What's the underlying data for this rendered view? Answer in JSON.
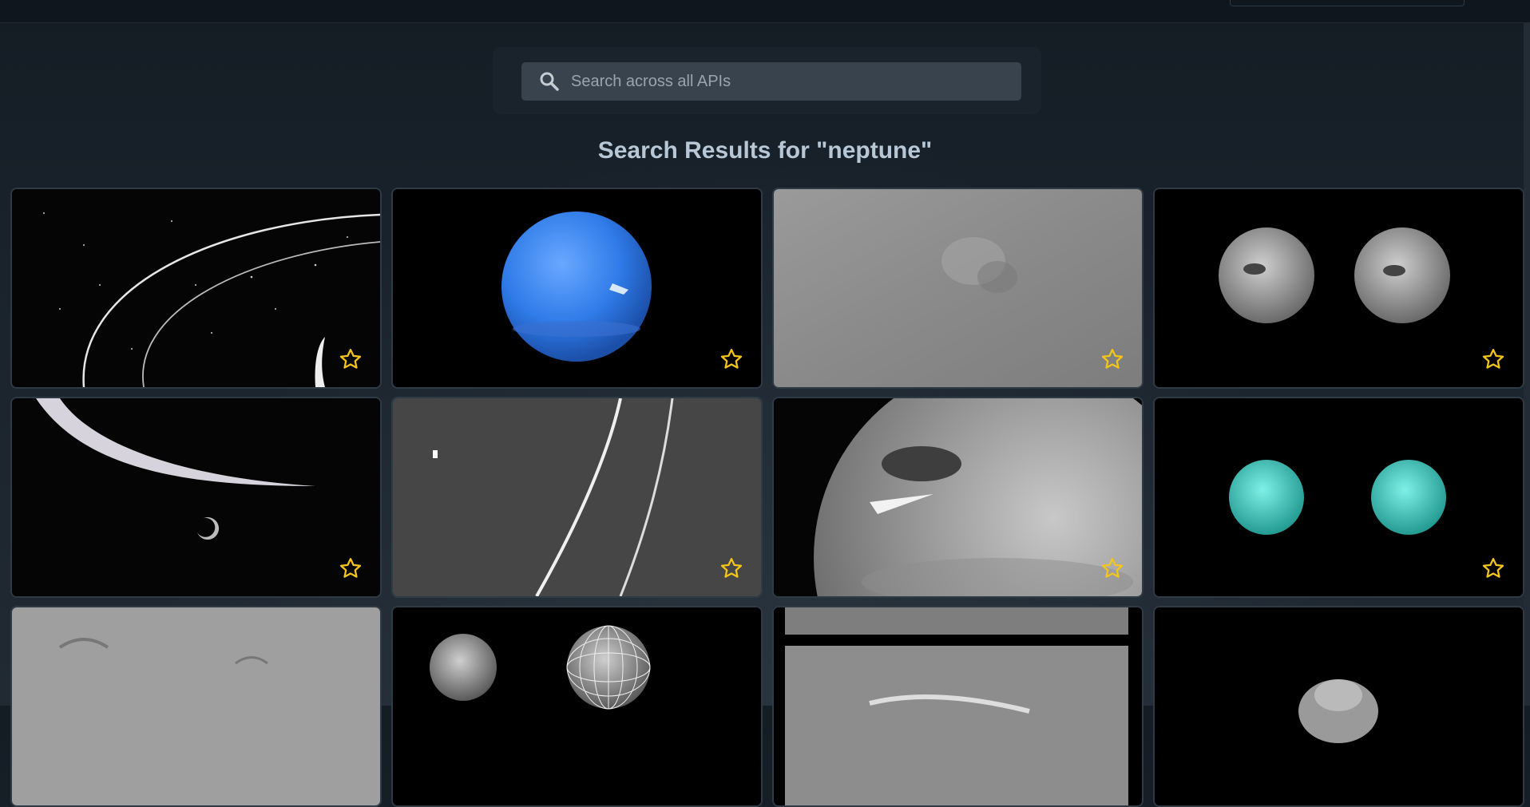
{
  "search": {
    "placeholder": "Search across all APIs"
  },
  "results": {
    "query": "neptune",
    "heading": "Search Results for \"neptune\""
  },
  "colors": {
    "star": "#f5c518",
    "background": "#1a232c",
    "heading": "#b7c7d6"
  },
  "icons": {
    "search": "search-icon",
    "favorite": "star-outline-icon"
  }
}
